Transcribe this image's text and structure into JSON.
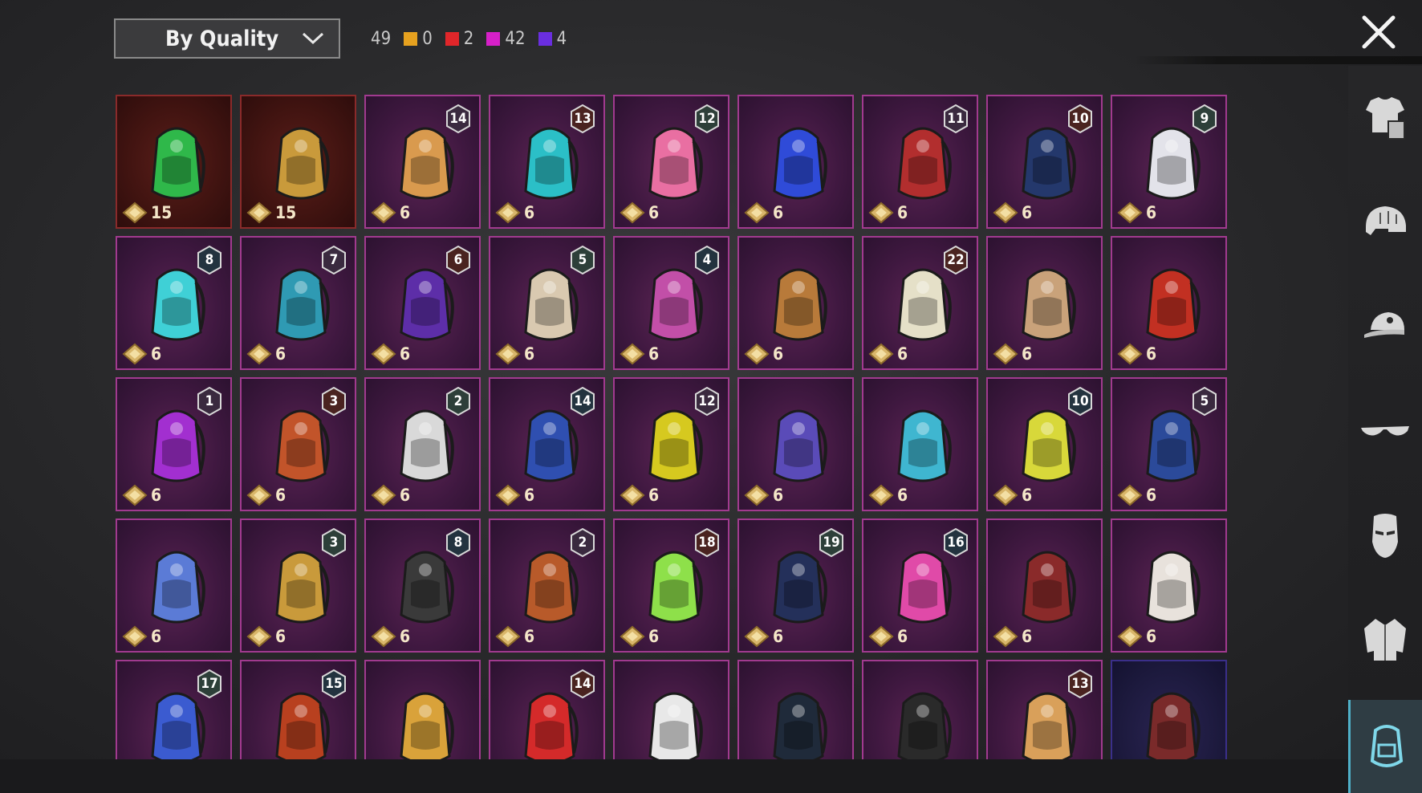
{
  "sort": {
    "label": "By Quality"
  },
  "counts": {
    "total": "49",
    "by_rarity": [
      {
        "color": "#e6a11f",
        "value": "0"
      },
      {
        "color": "#e0262a",
        "value": "2"
      },
      {
        "color": "#d620c8",
        "value": "42"
      },
      {
        "color": "#6a2ee0",
        "value": "4"
      }
    ]
  },
  "icons": {
    "close": "close-icon",
    "sidebar": [
      "outfit-icon",
      "helmet-icon",
      "cap-icon",
      "glasses-icon",
      "mask-icon",
      "jacket-icon",
      "backpack-icon"
    ]
  },
  "items": [
    {
      "rarity": "gold",
      "price": "15",
      "level": "",
      "art": "#2fb84a"
    },
    {
      "rarity": "gold",
      "price": "15",
      "level": "",
      "art": "#c99a3b"
    },
    {
      "rarity": "purple",
      "price": "6",
      "level": "14",
      "art": "#d99a4e"
    },
    {
      "rarity": "purple",
      "price": "6",
      "level": "13",
      "art": "#2bbfc7"
    },
    {
      "rarity": "purple",
      "price": "6",
      "level": "12",
      "art": "#e96fa2"
    },
    {
      "rarity": "purple",
      "price": "6",
      "level": "",
      "art": "#2f4bd8"
    },
    {
      "rarity": "purple",
      "price": "6",
      "level": "11",
      "art": "#b22e2e"
    },
    {
      "rarity": "purple",
      "price": "6",
      "level": "10",
      "art": "#24386c"
    },
    {
      "rarity": "purple",
      "price": "6",
      "level": "9",
      "art": "#e3e3ea"
    },
    {
      "rarity": "purple",
      "price": "6",
      "level": "8",
      "art": "#3fd0d6"
    },
    {
      "rarity": "purple",
      "price": "6",
      "level": "7",
      "art": "#2f9ab3"
    },
    {
      "rarity": "purple",
      "price": "6",
      "level": "6",
      "art": "#5d2ea8"
    },
    {
      "rarity": "purple",
      "price": "6",
      "level": "5",
      "art": "#d9c9b0"
    },
    {
      "rarity": "purple",
      "price": "6",
      "level": "4",
      "art": "#c24fa8"
    },
    {
      "rarity": "purple",
      "price": "6",
      "level": "",
      "art": "#b87a3a"
    },
    {
      "rarity": "purple",
      "price": "6",
      "level": "22",
      "art": "#e5e0c8"
    },
    {
      "rarity": "purple",
      "price": "6",
      "level": "",
      "art": "#c9a27a"
    },
    {
      "rarity": "purple",
      "price": "6",
      "level": "",
      "art": "#c23022"
    },
    {
      "rarity": "purple",
      "price": "6",
      "level": "1",
      "art": "#a22fd0"
    },
    {
      "rarity": "purple",
      "price": "6",
      "level": "3",
      "art": "#c2542a"
    },
    {
      "rarity": "purple",
      "price": "6",
      "level": "2",
      "art": "#d9d9d9"
    },
    {
      "rarity": "purple",
      "price": "6",
      "level": "14",
      "art": "#2f4fb0"
    },
    {
      "rarity": "purple",
      "price": "6",
      "level": "12",
      "art": "#d6c91f"
    },
    {
      "rarity": "purple",
      "price": "6",
      "level": "",
      "art": "#5a4bb8"
    },
    {
      "rarity": "purple",
      "price": "6",
      "level": "",
      "art": "#3fb6d0"
    },
    {
      "rarity": "purple",
      "price": "6",
      "level": "10",
      "art": "#d8d83a"
    },
    {
      "rarity": "purple",
      "price": "6",
      "level": "5",
      "art": "#2b4a9a"
    },
    {
      "rarity": "purple",
      "price": "6",
      "level": "",
      "art": "#5b7bd6"
    },
    {
      "rarity": "purple",
      "price": "6",
      "level": "3",
      "art": "#c99a3b"
    },
    {
      "rarity": "purple",
      "price": "6",
      "level": "8",
      "art": "#3a3a3a"
    },
    {
      "rarity": "purple",
      "price": "6",
      "level": "2",
      "art": "#b85a2a"
    },
    {
      "rarity": "purple",
      "price": "6",
      "level": "18",
      "art": "#8ee04a"
    },
    {
      "rarity": "purple",
      "price": "6",
      "level": "19",
      "art": "#24305a"
    },
    {
      "rarity": "purple",
      "price": "6",
      "level": "16",
      "art": "#e04aa8"
    },
    {
      "rarity": "purple",
      "price": "6",
      "level": "",
      "art": "#8a2a2a"
    },
    {
      "rarity": "purple",
      "price": "6",
      "level": "",
      "art": "#e8e2dc"
    },
    {
      "rarity": "purple",
      "price": "",
      "level": "17",
      "art": "#3b5bd0"
    },
    {
      "rarity": "purple",
      "price": "",
      "level": "15",
      "art": "#b8401f"
    },
    {
      "rarity": "purple",
      "price": "",
      "level": "",
      "art": "#d9a23a"
    },
    {
      "rarity": "purple",
      "price": "",
      "level": "14",
      "art": "#d42a2a"
    },
    {
      "rarity": "purple",
      "price": "",
      "level": "",
      "art": "#e8e8e8"
    },
    {
      "rarity": "purple",
      "price": "",
      "level": "",
      "art": "#1f2a3a"
    },
    {
      "rarity": "purple",
      "price": "",
      "level": "",
      "art": "#2a2a2a"
    },
    {
      "rarity": "purple",
      "price": "",
      "level": "13",
      "art": "#d9a05a"
    },
    {
      "rarity": "blue",
      "price": "",
      "level": "",
      "art": "#7a2a2a"
    }
  ]
}
